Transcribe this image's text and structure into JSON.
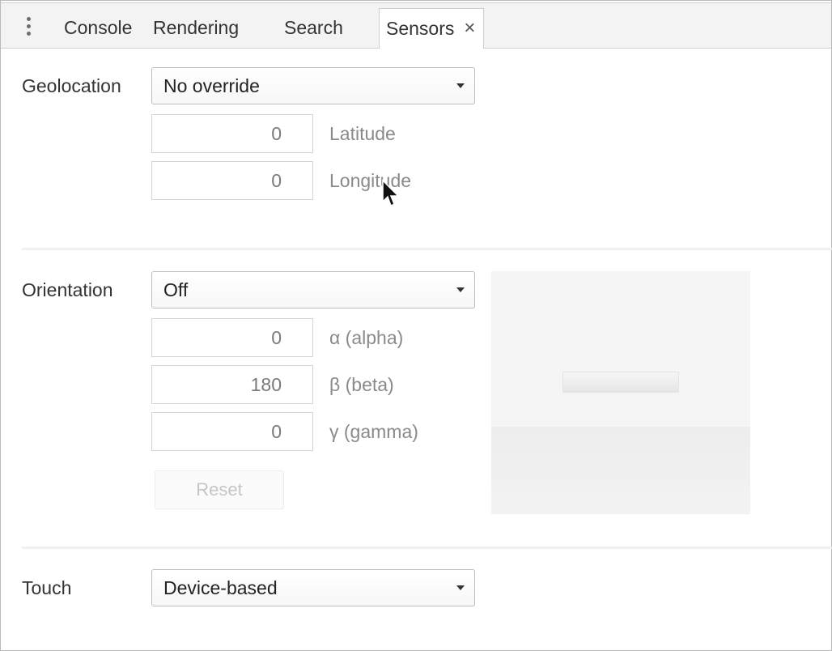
{
  "tabs": [
    {
      "label": "Console"
    },
    {
      "label": "Rendering"
    },
    {
      "label": "Search"
    },
    {
      "label": "Sensors",
      "close": "×"
    }
  ],
  "geolocation": {
    "label": "Geolocation",
    "selected": "No override",
    "latitude": {
      "value": "0",
      "label": "Latitude"
    },
    "longitude": {
      "value": "0",
      "label": "Longitude"
    }
  },
  "orientation": {
    "label": "Orientation",
    "selected": "Off",
    "alpha": {
      "value": "0",
      "label": "α (alpha)"
    },
    "beta": {
      "value": "180",
      "label": "β (beta)"
    },
    "gamma": {
      "value": "0",
      "label": "γ (gamma)"
    },
    "reset_label": "Reset"
  },
  "touch": {
    "label": "Touch",
    "selected": "Device-based"
  },
  "icons": {
    "menu": "more-vertical-icon",
    "close": "close-icon",
    "dropdown": "chevron-down-icon",
    "pointer": "mouse-cursor-icon"
  },
  "colors": {
    "tabbar_bg": "#f3f3f3",
    "border": "#cfcfcf",
    "text": "#333333",
    "muted_text": "#8a8a8a"
  }
}
